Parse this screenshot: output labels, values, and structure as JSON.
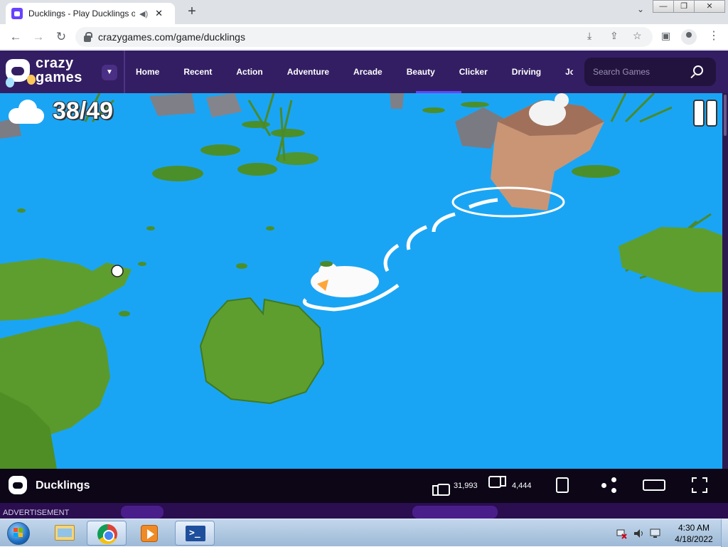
{
  "browser": {
    "tab_title": "Ducklings - Play Ducklings o",
    "tab_audio": "◀)",
    "tab_close": "✕",
    "new_tab": "+",
    "url": "crazygames.com/game/ducklings",
    "window_buttons": [
      "—",
      "❐",
      "✕"
    ]
  },
  "site": {
    "logo_line1": "crazy",
    "logo_line2": "games",
    "nav": [
      "Home",
      "Recent",
      "Action",
      "Adventure",
      "Arcade",
      "Beauty",
      "Clicker",
      "Driving",
      "Jo"
    ],
    "search_placeholder": "Search Games"
  },
  "game": {
    "score": "38/49",
    "title": "Ducklings",
    "likes": "31,993",
    "dislikes": "4,444"
  },
  "ad_label": "ADVERTISEMENT",
  "taskbar": {
    "time": "4:30 AM",
    "date": "4/18/2022",
    "powershell_glyph": ">_"
  },
  "colors": {
    "header_bg": "#331e63",
    "water": "#1aa5f4",
    "lily_pad": "#5e9e2f",
    "accent": "#6842ff"
  }
}
